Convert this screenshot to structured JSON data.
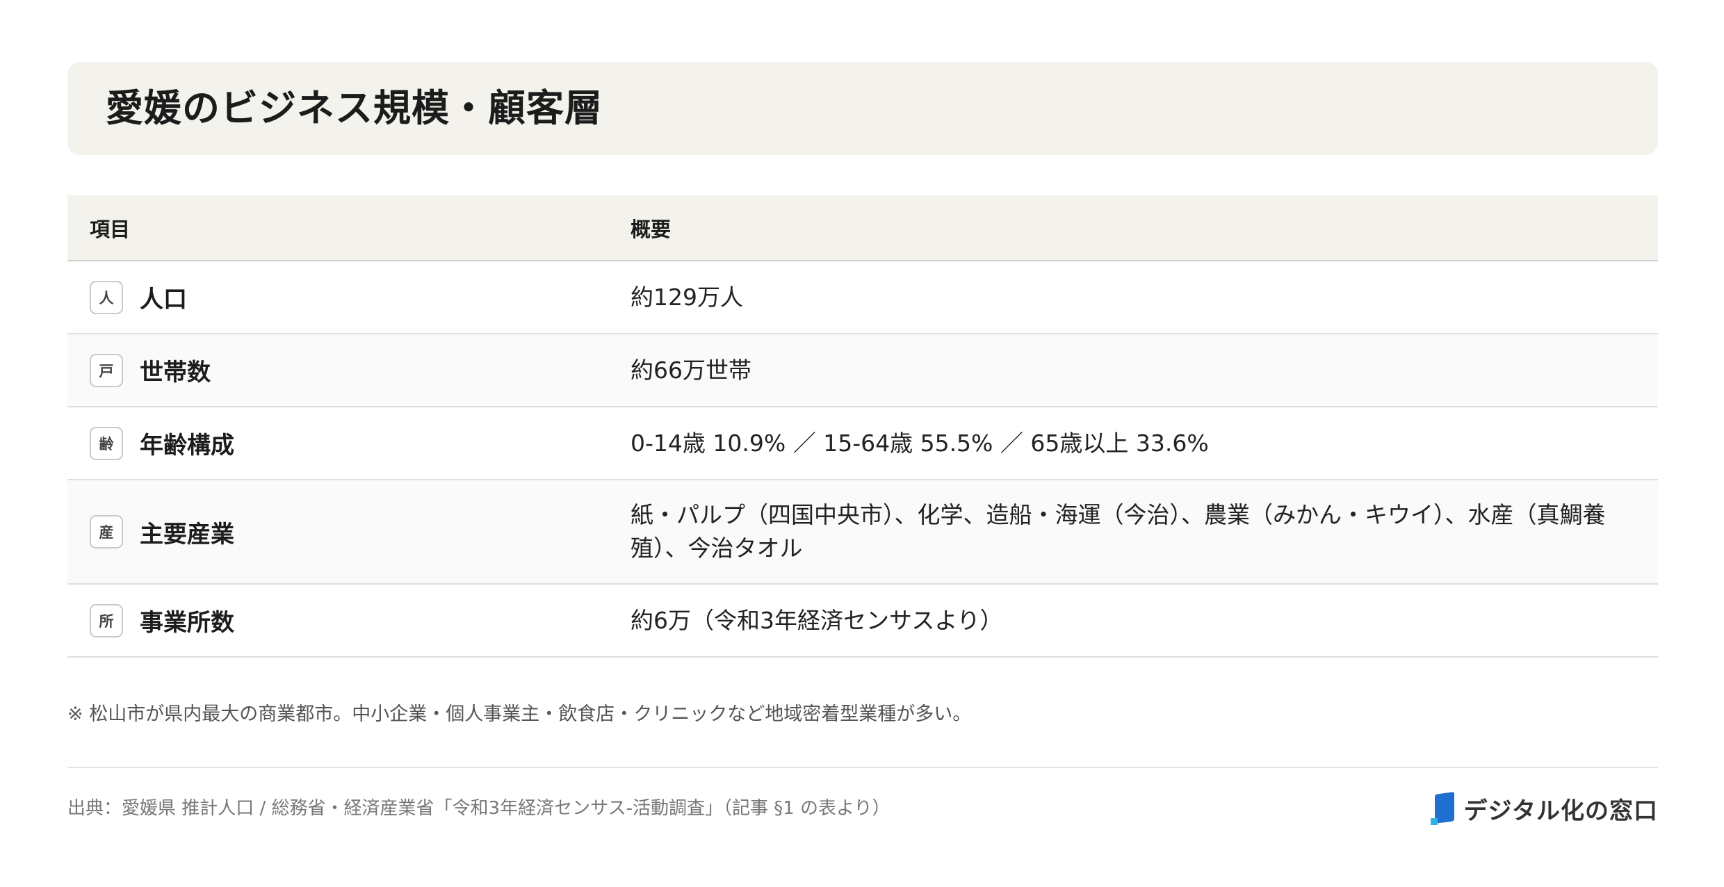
{
  "title": "愛媛のビジネス規模・顧客層",
  "table": {
    "headers": [
      "項目",
      "概要"
    ],
    "rows": [
      {
        "badge": "人",
        "item": "人口",
        "summary": "約129万人"
      },
      {
        "badge": "戸",
        "item": "世帯数",
        "summary": "約66万世帯"
      },
      {
        "badge": "齢",
        "item": "年齢構成",
        "summary": "0-14歳 10.9% ／ 15-64歳 55.5% ／ 65歳以上 33.6%"
      },
      {
        "badge": "産",
        "item": "主要産業",
        "summary": "紙・パルプ（四国中央市）、化学、造船・海運（今治）、農業（みかん・キウイ）、水産（真鯛養殖）、今治タオル"
      },
      {
        "badge": "所",
        "item": "事業所数",
        "summary": "約6万（令和3年経済センサスより）"
      }
    ]
  },
  "note": "※ 松山市が県内最大の商業都市。中小企業・個人事業主・飲食店・クリニックなど地域密着型業種が多い。",
  "source": "出典：愛媛県 推計人口 / 総務省・経済産業省「令和3年経済センサス‐活動調査」（記事 §1 の表より）",
  "logo": {
    "text": "デジタル化の窓口",
    "icon": "door-icon",
    "colors": {
      "primary": "#1f6fd1",
      "accent": "#2fb2e8"
    }
  }
}
